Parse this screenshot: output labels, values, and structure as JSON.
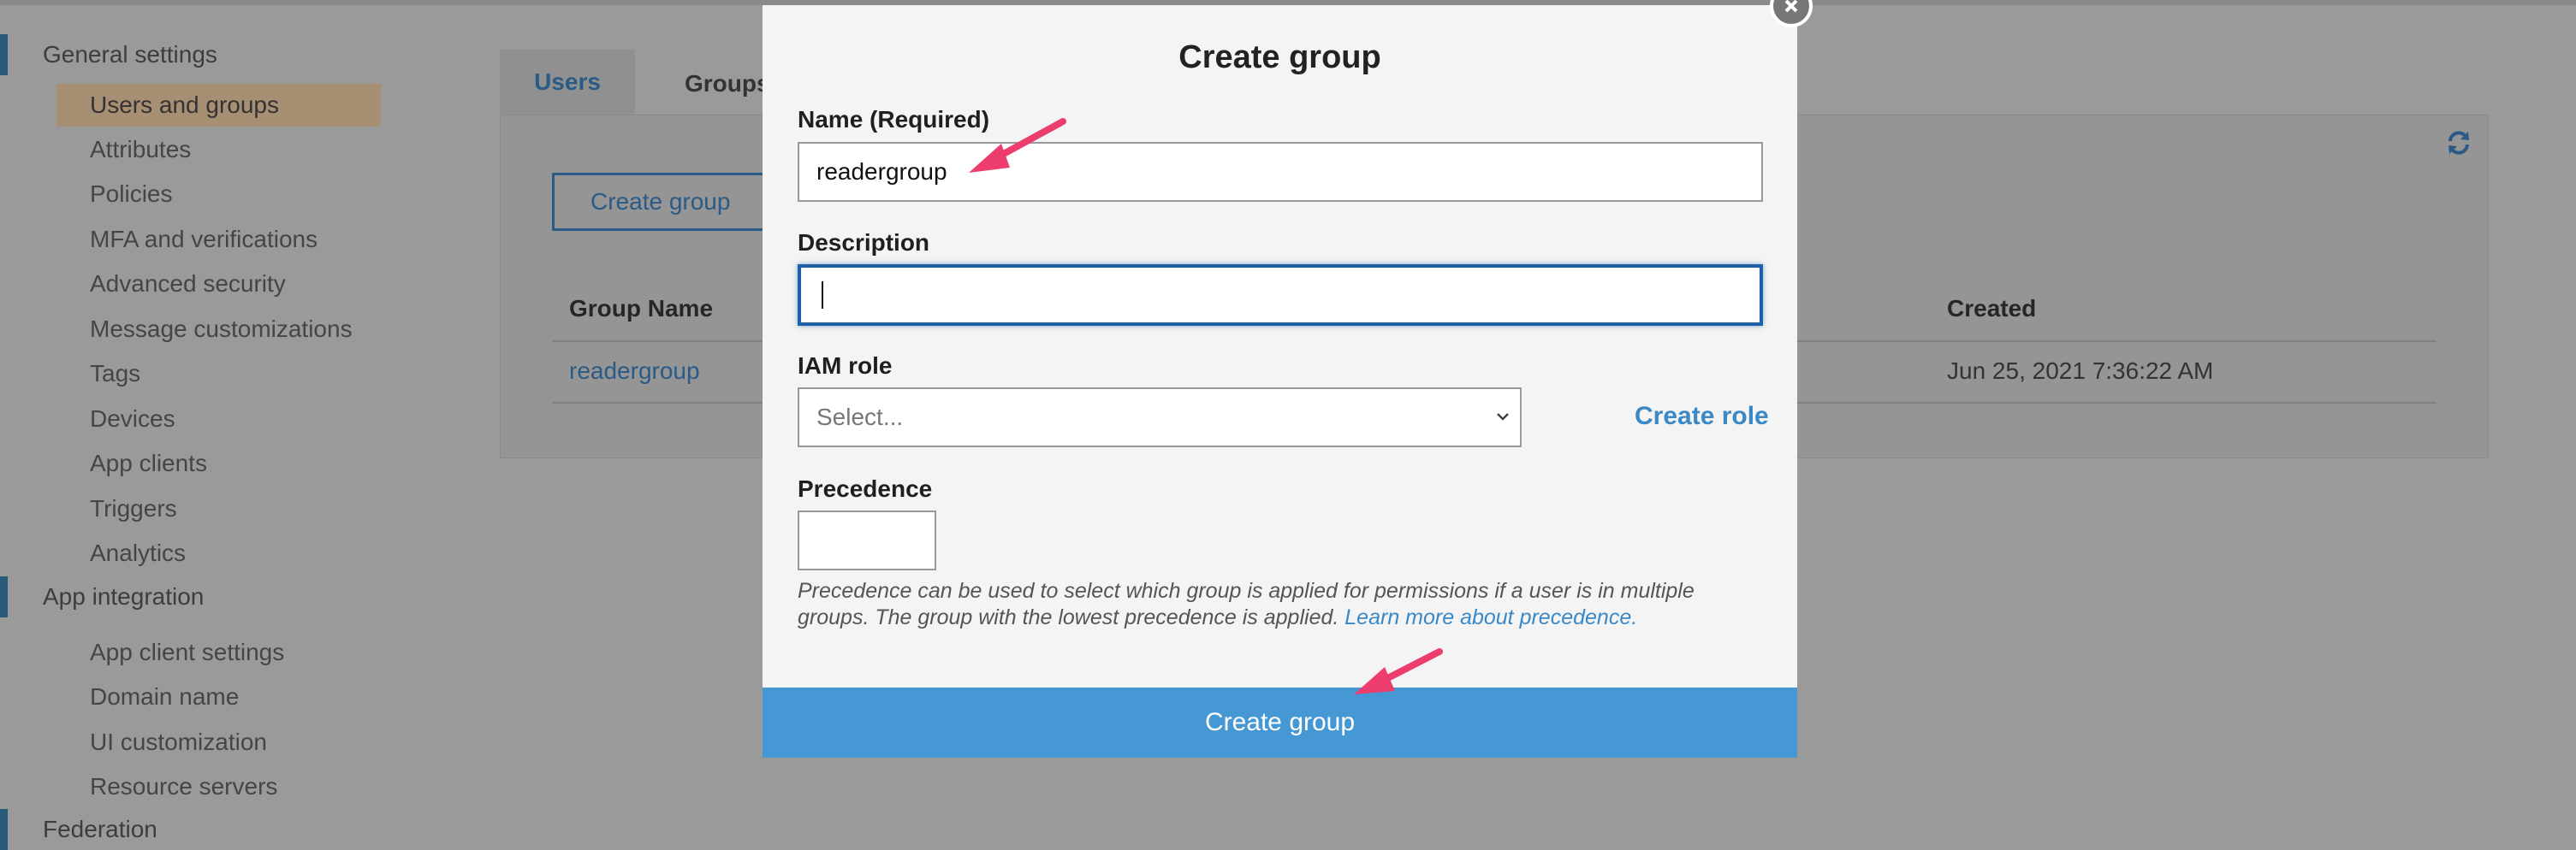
{
  "sidebar": {
    "sections": [
      {
        "label": "General settings"
      },
      {
        "label": "App integration"
      },
      {
        "label": "Federation"
      }
    ],
    "general_items": [
      {
        "label": "Users and groups"
      },
      {
        "label": "Attributes"
      },
      {
        "label": "Policies"
      },
      {
        "label": "MFA and verifications"
      },
      {
        "label": "Advanced security"
      },
      {
        "label": "Message customizations"
      },
      {
        "label": "Tags"
      },
      {
        "label": "Devices"
      },
      {
        "label": "App clients"
      },
      {
        "label": "Triggers"
      },
      {
        "label": "Analytics"
      }
    ],
    "app_items": [
      {
        "label": "App client settings"
      },
      {
        "label": "Domain name"
      },
      {
        "label": "UI customization"
      },
      {
        "label": "Resource servers"
      }
    ]
  },
  "tabs": {
    "users": "Users",
    "groups": "Groups"
  },
  "main": {
    "create_group_button": "Create group",
    "table": {
      "headers": {
        "group_name": "Group Name",
        "created": "Created"
      },
      "rows": [
        {
          "group_name": "readergroup",
          "created": "Jun 25, 2021 7:36:22 AM"
        }
      ]
    }
  },
  "modal": {
    "title": "Create group",
    "name_label": "Name (Required)",
    "name_value": "readergroup",
    "description_label": "Description",
    "description_value": "",
    "iam_label": "IAM role",
    "iam_placeholder": "Select...",
    "create_role": "Create role",
    "precedence_label": "Precedence",
    "precedence_value": "",
    "help_text": "Precedence can be used to select which group is applied for permissions if a user is in multiple groups. The group with the lowest precedence is applied.",
    "help_link": "Learn more about precedence.",
    "submit": "Create group"
  },
  "colors": {
    "accent": "#4598d4",
    "link": "#3a88c6",
    "annotation_arrow": "#ec3d6e",
    "focus_border": "#1f5fa8"
  },
  "icons": [
    "refresh-icon",
    "close-icon",
    "chevron-down-icon",
    "annotation-arrow"
  ]
}
